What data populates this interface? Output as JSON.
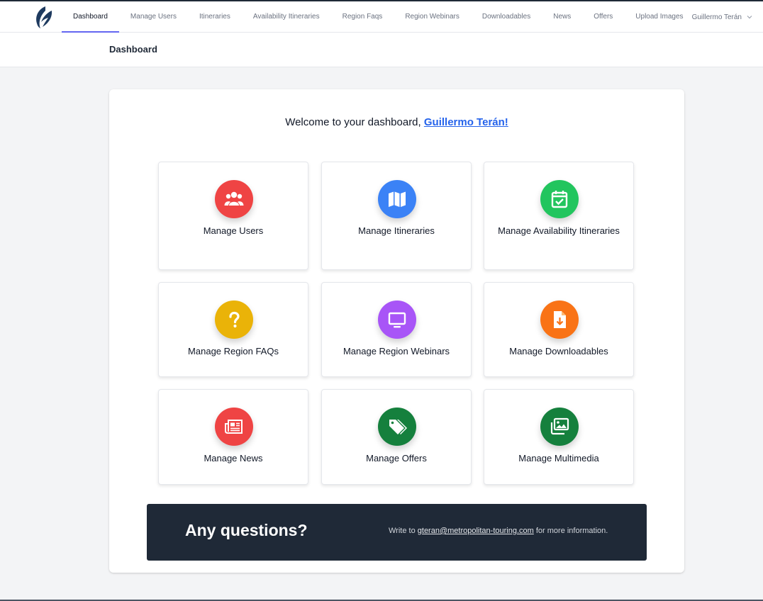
{
  "nav": {
    "links": [
      {
        "label": "Dashboard",
        "active": true
      },
      {
        "label": "Manage Users"
      },
      {
        "label": "Itineraries"
      },
      {
        "label": "Availability Itineraries"
      },
      {
        "label": "Region Faqs"
      },
      {
        "label": "Region Webinars"
      },
      {
        "label": "Downloadables"
      },
      {
        "label": "News"
      },
      {
        "label": "Offers"
      },
      {
        "label": "Upload Images"
      }
    ],
    "user_name": "Guillermo Terán"
  },
  "header": {
    "title": "Dashboard"
  },
  "welcome": {
    "prefix": "Welcome to your dashboard, ",
    "user_name": "Guillermo Terán!"
  },
  "tiles": [
    {
      "label": "Manage Users",
      "icon": "users-icon",
      "color": "#ef4444"
    },
    {
      "label": "Manage Itineraries",
      "icon": "map-icon",
      "color": "#3b82f6"
    },
    {
      "label": "Manage Availability Itineraries",
      "icon": "calendar-check-icon",
      "color": "#22c55e"
    },
    {
      "label": "Manage Region FAQs",
      "icon": "question-icon",
      "color": "#eab308"
    },
    {
      "label": "Manage Region Webinars",
      "icon": "monitor-icon",
      "color": "#a855f7"
    },
    {
      "label": "Manage Downloadables",
      "icon": "file-download-icon",
      "color": "#f97316"
    },
    {
      "label": "Manage News",
      "icon": "newspaper-icon",
      "color": "#ef4444"
    },
    {
      "label": "Manage Offers",
      "icon": "tags-icon",
      "color": "#15803d"
    },
    {
      "label": "Manage Multimedia",
      "icon": "images-icon",
      "color": "#15803d"
    }
  ],
  "banner": {
    "title": "Any questions?",
    "text_prefix": "Write to ",
    "email": "gteran@metropolitan-touring.com",
    "text_suffix": " for more information."
  }
}
